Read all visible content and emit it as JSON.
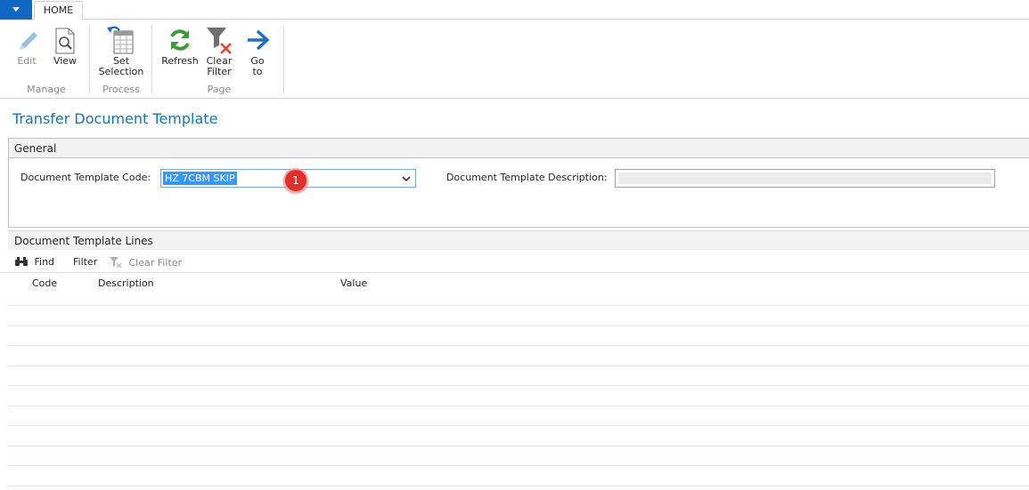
{
  "ribbon": {
    "tab": "HOME",
    "buttons": {
      "edit": "Edit",
      "view": "View",
      "set_selection": [
        "Set",
        "Selection"
      ],
      "refresh": "Refresh",
      "clear_filter": [
        "Clear",
        "Filter"
      ],
      "go_to": [
        "Go",
        "to"
      ]
    },
    "groups": {
      "manage": "Manage",
      "process": "Process",
      "page": "Page"
    }
  },
  "page": {
    "title": "Transfer Document Template",
    "general": {
      "header": "General",
      "code_label": "Document Template Code:",
      "code_value": "HZ 7CBM SKIP",
      "desc_label": "Document Template Description:",
      "desc_value": ""
    },
    "badge": "1",
    "lines": {
      "header": "Document Template Lines",
      "actions": {
        "find": "Find",
        "filter": "Filter",
        "clear_filter": "Clear Filter"
      },
      "columns": {
        "code": "Code",
        "description": "Description",
        "value": "Value"
      }
    }
  },
  "colors": {
    "accent": "#1068c4",
    "title": "#1a73ba",
    "badge": "#e1302c",
    "selection": "#3399ff"
  }
}
